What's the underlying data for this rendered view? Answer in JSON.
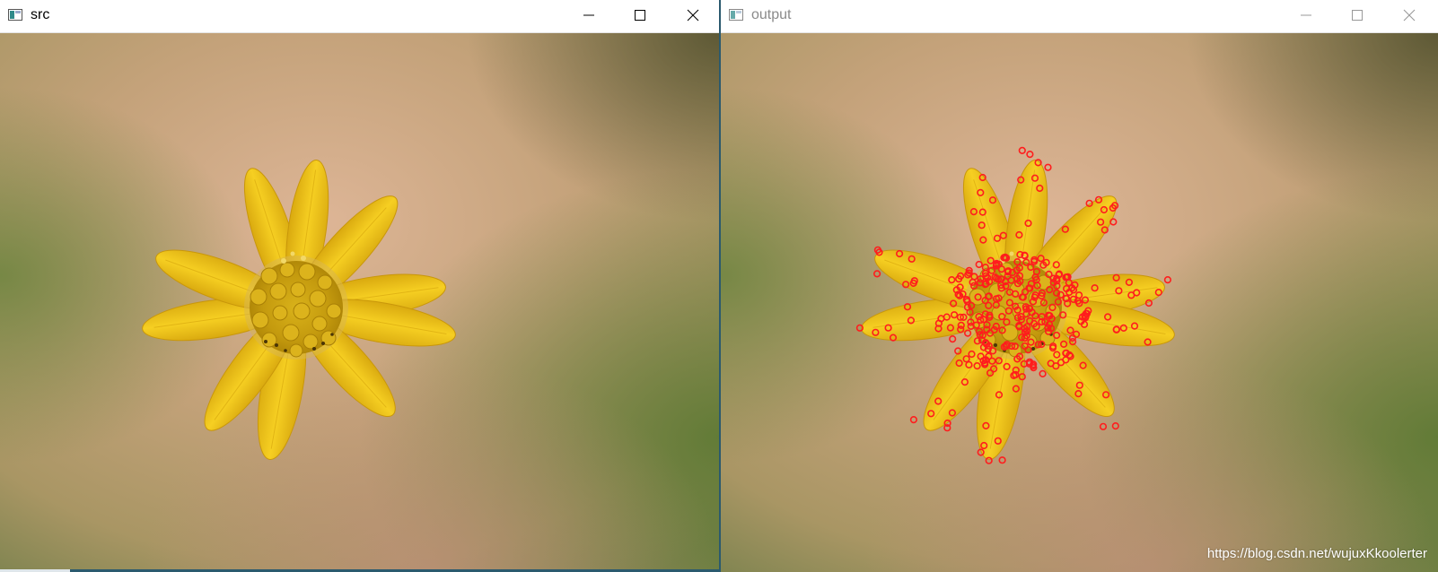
{
  "windows": [
    {
      "id": "src",
      "title": "src",
      "active": true
    },
    {
      "id": "out",
      "title": "output",
      "active": false
    }
  ],
  "watermark": "https://blog.csdn.net/wujuxKkoolerter",
  "colors": {
    "petal": "#f0c51a",
    "petal_dark": "#d6a30c",
    "center": "#c9a010",
    "keypoint": "#ff1d1d"
  },
  "icons": [
    "app-icon",
    "minimize-icon",
    "maximize-icon",
    "close-icon"
  ]
}
